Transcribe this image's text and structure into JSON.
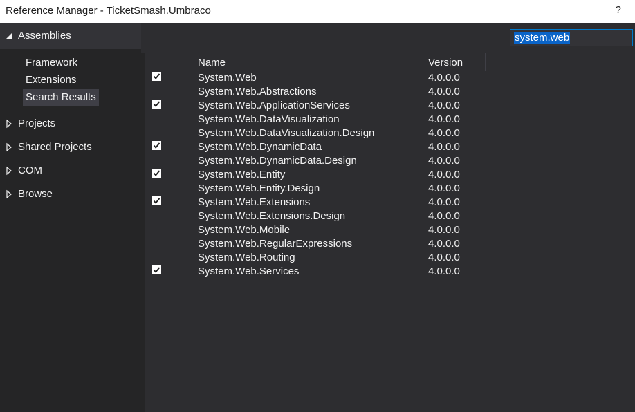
{
  "window": {
    "title": "Reference Manager - TicketSmash.Umbraco",
    "help_label": "?"
  },
  "nav": {
    "assemblies": "Assemblies",
    "sub_items": [
      "Framework",
      "Extensions",
      "Search Results"
    ],
    "selected_sub": "Search Results",
    "nodes": [
      "Projects",
      "Shared Projects",
      "COM",
      "Browse"
    ]
  },
  "search": {
    "value": "system.web"
  },
  "grid": {
    "columns": {
      "name": "Name",
      "version": "Version"
    },
    "rows": [
      {
        "name": "System.Web",
        "version": "4.0.0.0",
        "checked": true
      },
      {
        "name": "System.Web.Abstractions",
        "version": "4.0.0.0",
        "checked": false
      },
      {
        "name": "System.Web.ApplicationServices",
        "version": "4.0.0.0",
        "checked": true
      },
      {
        "name": "System.Web.DataVisualization",
        "version": "4.0.0.0",
        "checked": false
      },
      {
        "name": "System.Web.DataVisualization.Design",
        "version": "4.0.0.0",
        "checked": false
      },
      {
        "name": "System.Web.DynamicData",
        "version": "4.0.0.0",
        "checked": true
      },
      {
        "name": "System.Web.DynamicData.Design",
        "version": "4.0.0.0",
        "checked": false
      },
      {
        "name": "System.Web.Entity",
        "version": "4.0.0.0",
        "checked": true
      },
      {
        "name": "System.Web.Entity.Design",
        "version": "4.0.0.0",
        "checked": false
      },
      {
        "name": "System.Web.Extensions",
        "version": "4.0.0.0",
        "checked": true
      },
      {
        "name": "System.Web.Extensions.Design",
        "version": "4.0.0.0",
        "checked": false
      },
      {
        "name": "System.Web.Mobile",
        "version": "4.0.0.0",
        "checked": false
      },
      {
        "name": "System.Web.RegularExpressions",
        "version": "4.0.0.0",
        "checked": false
      },
      {
        "name": "System.Web.Routing",
        "version": "4.0.0.0",
        "checked": false
      },
      {
        "name": "System.Web.Services",
        "version": "4.0.0.0",
        "checked": true
      }
    ]
  }
}
